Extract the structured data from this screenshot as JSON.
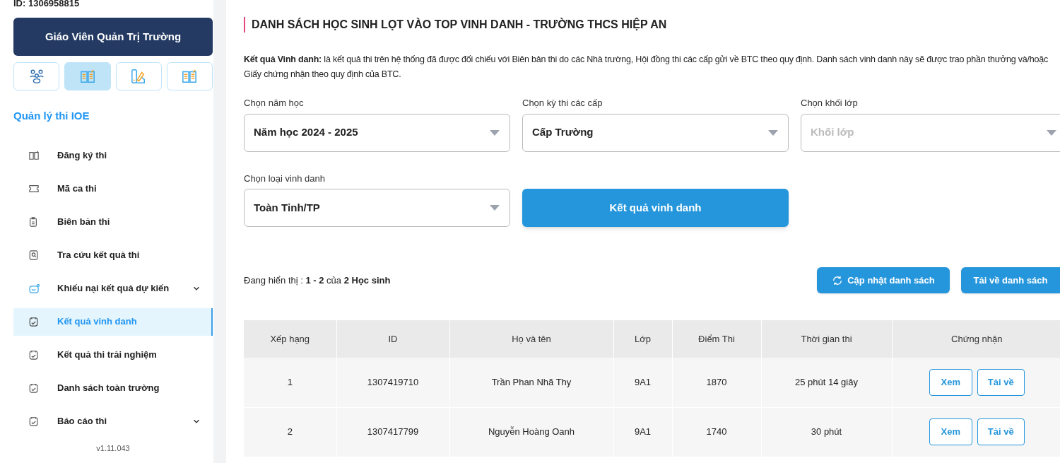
{
  "user_id": "ID: 1306958815",
  "role_button": "Giáo Viên Quản Trị Trường",
  "mode_tabs": [
    {
      "selected": false
    },
    {
      "selected": true
    },
    {
      "selected": false
    },
    {
      "selected": false
    }
  ],
  "section_title": "Quản lý thi IOE",
  "menu": [
    {
      "label": "Đăng ký thi",
      "selected": false,
      "expandable": false
    },
    {
      "label": "Mã ca thi",
      "selected": false,
      "expandable": false
    },
    {
      "label": "Biên bản thi",
      "selected": false,
      "expandable": false
    },
    {
      "label": "Tra cứu kết quả thi",
      "selected": false,
      "expandable": false
    },
    {
      "label": "Khiếu nại kết quả dự kiến",
      "selected": false,
      "expandable": true
    },
    {
      "label": "Kết quả vinh danh",
      "selected": true,
      "expandable": false
    },
    {
      "label": "Kết quả thi trải nghiệm",
      "selected": false,
      "expandable": false
    },
    {
      "label": "Danh sách toàn trường",
      "selected": false,
      "expandable": false
    },
    {
      "label": "Báo cáo thi",
      "selected": false,
      "expandable": true
    }
  ],
  "version": "v1.11.043",
  "page_title": "DANH SÁCH HỌC SINH LỌT VÀO TOP VINH DANH - TRƯỜNG THCS HIỆP AN",
  "description": "**Kết quả Vinh danh:** là kết quả thi trên hệ thống đã được đối chiếu với Biên bản thi do các Nhà trường, Hội đồng thi các cấp gửi về BTC theo quy định. Danh sách vinh danh này sẽ được trao phần thưởng và/hoặc Giấy chứng nhận theo quy định của BTC.",
  "filters": [
    {
      "label": "Chọn năm học",
      "value": "Năm học 2024 - 2025"
    },
    {
      "label": "Chọn kỳ thi các cấp",
      "value": "Cấp Trường"
    },
    {
      "label": "Chọn khối lớp",
      "placeholder": "Khối lớp"
    },
    {
      "label": "Chọn loại vinh danh",
      "value": "Toàn Tỉnh/TP"
    }
  ],
  "result_button": "Kết quả vinh danh",
  "showing": "Đang hiển thị : **1 - 2** của **2 Học sinh**",
  "refresh_button": "Cập nhật danh sách",
  "download_button": "Tải về danh sách",
  "table": {
    "columns": [
      "Xếp hạng",
      "ID",
      "Họ và tên",
      "Lớp",
      "Điểm Thi",
      "Thời gian thi",
      "Chứng nhận"
    ],
    "rows": [
      {
        "cells": [
          "1",
          "1307419710",
          "Trần Phan Nhã Thy",
          "9A1",
          "1870",
          "25 phút 14 giây"
        ],
        "actions": [
          "Xem",
          "Tải về"
        ]
      },
      {
        "cells": [
          "2",
          "1307417799",
          "Nguyễn Hoàng Oanh",
          "9A1",
          "1740",
          "30 phút"
        ],
        "actions": [
          "Xem",
          "Tải về"
        ]
      }
    ]
  }
}
